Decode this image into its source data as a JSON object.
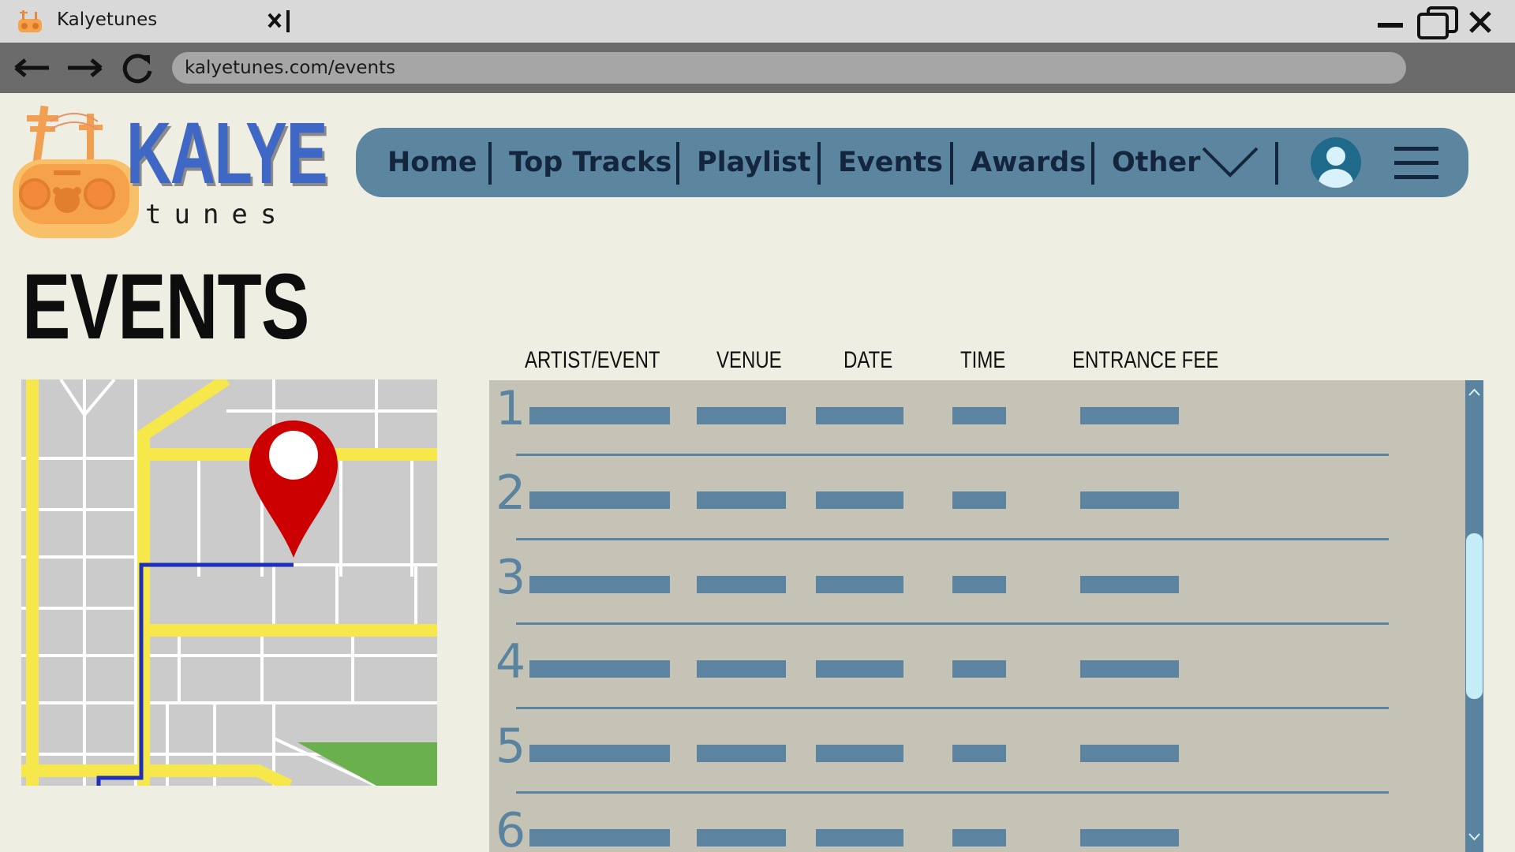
{
  "browser": {
    "tab_title": "Kalyetunes",
    "url": "kalyetunes.com/events"
  },
  "site": {
    "logo_word": "KALYE",
    "logo_sub": "tunes",
    "nav": [
      "Home",
      "Top Tracks",
      "Playlist",
      "Events",
      "Awards",
      "Other"
    ]
  },
  "page": {
    "title": "EVENTS"
  },
  "table": {
    "columns": [
      "ARTIST/EVENT",
      "VENUE",
      "DATE",
      "TIME",
      "ENTRANCE FEE"
    ],
    "rows": [
      "1",
      "2",
      "3",
      "4",
      "5",
      "6"
    ]
  },
  "colors": {
    "nav_bg": "#5c86a0",
    "accent_blue": "#3f68c6",
    "table_bg": "#c4c3b5",
    "placeholder_bar": "#5c84a0",
    "pin_red": "#cc0000"
  }
}
